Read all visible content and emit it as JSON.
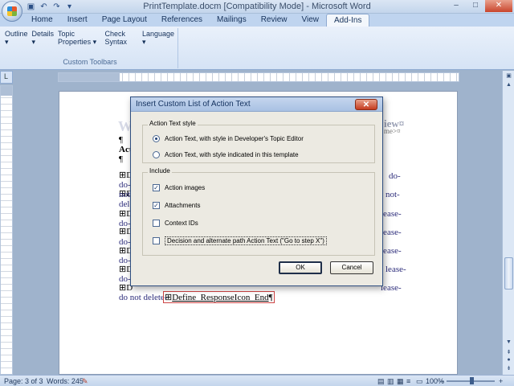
{
  "window": {
    "title": "PrintTemplate.docm [Compatibility Mode] - Microsoft Word",
    "minimize": "–",
    "maximize": "□",
    "close": "✕"
  },
  "quick_access": {
    "save_icon": "save-icon",
    "undo_icon": "undo-icon",
    "redo_icon": "redo-icon"
  },
  "tabs": [
    "Home",
    "Insert",
    "Page Layout",
    "References",
    "Mailings",
    "Review",
    "View",
    "Add-Ins"
  ],
  "active_tab": "Add-Ins",
  "ribbon": {
    "menus": [
      "Outline ▾",
      "Details ▾",
      "Topic Properties ▾",
      "Check Syntax",
      "Language ▾"
    ],
    "group_label": "Custom Toolbars"
  },
  "document": {
    "heading_fragment": "W",
    "title_fragment": "iew¤",
    "tag_fragment": "me>¤",
    "bold_fragment": "Act",
    "lines": [
      {
        "left": "do-",
        "right": ""
      },
      {
        "left": "not",
        "right": "not-"
      },
      {
        "left": "dele",
        "right": ""
      },
      {
        "left": "",
        "right": "lease-"
      },
      {
        "left": "do-",
        "right": ""
      },
      {
        "left": "",
        "right": "lease-"
      },
      {
        "left": "do-",
        "right": ""
      },
      {
        "left": "",
        "right": "lease-"
      },
      {
        "left": "do-",
        "right": ""
      },
      {
        "left": "",
        "right": "lease-"
      },
      {
        "left": "do-",
        "right": ""
      },
      {
        "left": "",
        "right": "lease-"
      }
    ],
    "last_line_left": "do not delete-",
    "last_line_field": "Define_ResponseIcon_End",
    "pilcrow": "¶"
  },
  "dialog": {
    "title": "Insert Custom List of Action Text",
    "close_label": "✕",
    "style_group_label": "Action Text style",
    "style_options": [
      {
        "label": "Action Text, with style in Developer's Topic Editor",
        "selected": true
      },
      {
        "label": "Action Text, with style indicated in this template",
        "selected": false
      }
    ],
    "include_group_label": "Include",
    "include_options": [
      {
        "label": "Action images",
        "checked": true
      },
      {
        "label": "Attachments",
        "checked": true
      },
      {
        "label": "Context IDs",
        "checked": false
      },
      {
        "label": "Decision and alternate path Action Text (\"Go to step X\")",
        "checked": false
      }
    ],
    "ok_label": "OK",
    "cancel_label": "Cancel"
  },
  "status": {
    "page": "Page: 3 of 3",
    "words": "Words: 245",
    "zoom": "100%",
    "zoom_out": "–",
    "zoom_in": "+"
  }
}
